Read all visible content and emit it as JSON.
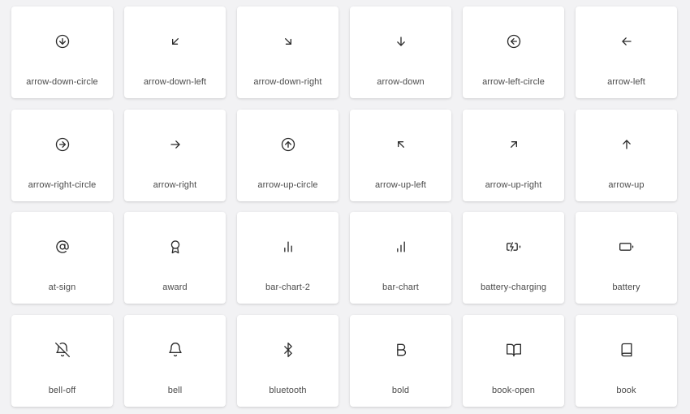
{
  "icons": [
    {
      "label": "arrow-down-circle",
      "icon": "arrow-down-circle-icon"
    },
    {
      "label": "arrow-down-left",
      "icon": "arrow-down-left-icon"
    },
    {
      "label": "arrow-down-right",
      "icon": "arrow-down-right-icon"
    },
    {
      "label": "arrow-down",
      "icon": "arrow-down-icon"
    },
    {
      "label": "arrow-left-circle",
      "icon": "arrow-left-circle-icon"
    },
    {
      "label": "arrow-left",
      "icon": "arrow-left-icon"
    },
    {
      "label": "arrow-right-circle",
      "icon": "arrow-right-circle-icon"
    },
    {
      "label": "arrow-right",
      "icon": "arrow-right-icon"
    },
    {
      "label": "arrow-up-circle",
      "icon": "arrow-up-circle-icon"
    },
    {
      "label": "arrow-up-left",
      "icon": "arrow-up-left-icon"
    },
    {
      "label": "arrow-up-right",
      "icon": "arrow-up-right-icon"
    },
    {
      "label": "arrow-up",
      "icon": "arrow-up-icon"
    },
    {
      "label": "at-sign",
      "icon": "at-sign-icon"
    },
    {
      "label": "award",
      "icon": "award-icon"
    },
    {
      "label": "bar-chart-2",
      "icon": "bar-chart-2-icon"
    },
    {
      "label": "bar-chart",
      "icon": "bar-chart-icon"
    },
    {
      "label": "battery-charging",
      "icon": "battery-charging-icon"
    },
    {
      "label": "battery",
      "icon": "battery-icon"
    },
    {
      "label": "bell-off",
      "icon": "bell-off-icon"
    },
    {
      "label": "bell",
      "icon": "bell-icon"
    },
    {
      "label": "bluetooth",
      "icon": "bluetooth-icon"
    },
    {
      "label": "bold",
      "icon": "bold-icon"
    },
    {
      "label": "book-open",
      "icon": "book-open-icon"
    },
    {
      "label": "book",
      "icon": "book-icon"
    }
  ],
  "colors": {
    "background": "#f2f2f4",
    "card": "#ffffff",
    "icon_stroke": "#2b2b2b",
    "label_text": "#4a4a4a"
  }
}
